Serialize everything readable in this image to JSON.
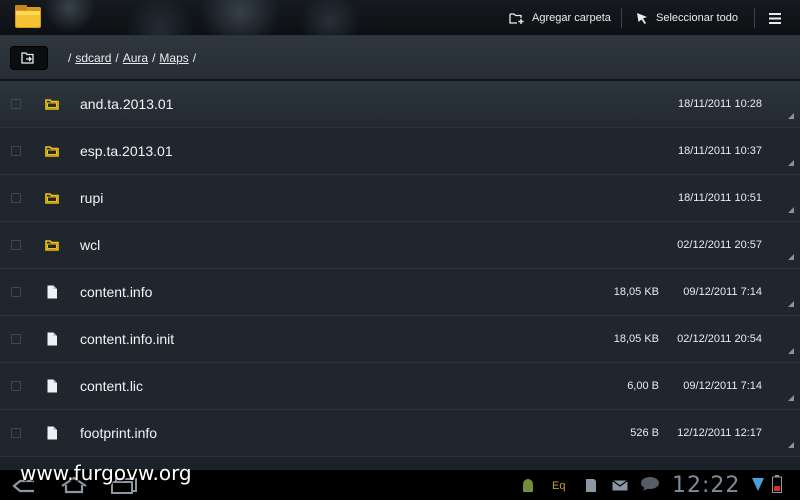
{
  "actionbar": {
    "add_folder_label": "Agregar carpeta",
    "select_all_label": "Seleccionar todo"
  },
  "path": {
    "segments": [
      "sdcard",
      "Aura",
      "Maps"
    ]
  },
  "files": [
    {
      "name": "and.ta.2013.01",
      "type": "folder",
      "size": "",
      "date": "18/11/2011 10:28"
    },
    {
      "name": "esp.ta.2013.01",
      "type": "folder",
      "size": "",
      "date": "18/11/2011 10:37"
    },
    {
      "name": "rupi",
      "type": "folder",
      "size": "",
      "date": "18/11/2011 10:51"
    },
    {
      "name": "wcl",
      "type": "folder",
      "size": "",
      "date": "02/12/2011 20:57"
    },
    {
      "name": "content.info",
      "type": "file",
      "size": "18,05 KB",
      "date": "09/12/2011 7:14"
    },
    {
      "name": "content.info.init",
      "type": "file",
      "size": "18,05 KB",
      "date": "02/12/2011 20:54"
    },
    {
      "name": "content.lic",
      "type": "file",
      "size": "6,00 B",
      "date": "09/12/2011 7:14"
    },
    {
      "name": "footprint.info",
      "type": "file",
      "size": "526 B",
      "date": "12/12/2011 12:17"
    }
  ],
  "statusbar": {
    "time": "12:22",
    "eq_label": "Eq"
  },
  "watermark": "www.furgovw.org",
  "colors": {
    "folder": "#f1c40f",
    "background": "#1f262d"
  }
}
